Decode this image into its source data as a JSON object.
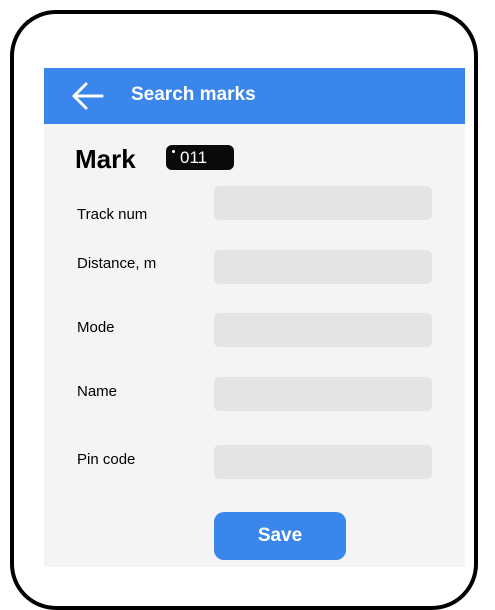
{
  "app_bar": {
    "title": "Search marks",
    "back_icon": "arrow-left-icon",
    "color": "#3a86ea"
  },
  "mark": {
    "heading": "Mark",
    "badge": "011"
  },
  "form": {
    "fields": [
      {
        "label": "Track num",
        "value": ""
      },
      {
        "label": "Distance, m",
        "value": ""
      },
      {
        "label": "Mode",
        "value": ""
      },
      {
        "label": "Name",
        "value": ""
      },
      {
        "label": "Pin code",
        "value": ""
      }
    ],
    "save_label": "Save"
  }
}
